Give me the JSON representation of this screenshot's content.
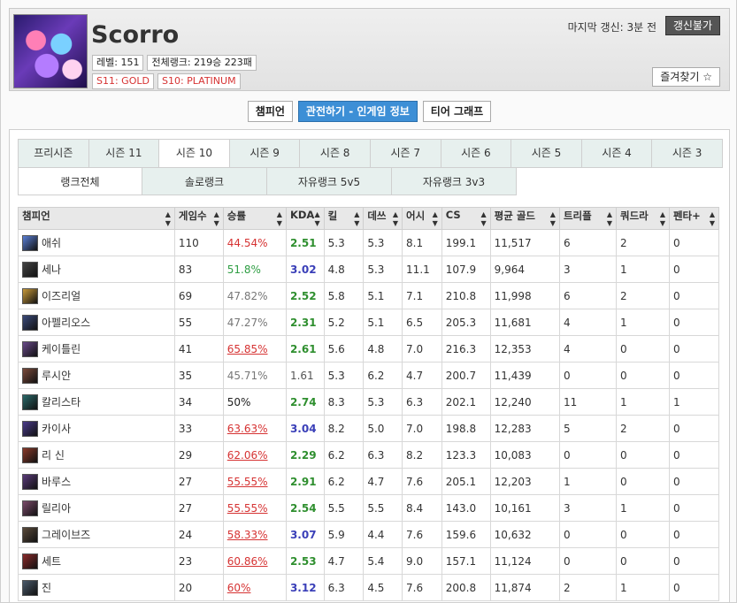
{
  "summoner": {
    "name": "Scorro",
    "level": "레벨: 151",
    "overall_rank": "전체랭크: 219승 223패",
    "ranks": [
      "S11: GOLD",
      "S10: PLATINUM"
    ]
  },
  "header": {
    "last_update": "마지막 갱신: 3분 전",
    "refresh_button": "갱신불가",
    "favorite_button": "즐겨찾기 ☆"
  },
  "view_tabs": [
    "챔피언",
    "관전하기 - 인게임 정보",
    "티어 그래프"
  ],
  "season_tabs": [
    "프리시즌",
    "시즌 11",
    "시즌 10",
    "시즌 9",
    "시즌 8",
    "시즌 7",
    "시즌 6",
    "시즌 5",
    "시즌 4",
    "시즌 3"
  ],
  "queue_tabs": [
    "랭크전체",
    "솔로랭크",
    "자유랭크 5v5",
    "자유랭크 3v3"
  ],
  "table": {
    "headers": [
      "챔피언",
      "게임수",
      "승률",
      "KDA",
      "킬",
      "데쓰",
      "어시",
      "CS",
      "평균 골드",
      "트리플",
      "쿼드라",
      "펜타+"
    ],
    "sort_icon": "▲▼",
    "rows": [
      {
        "champ": "애쉬",
        "games": "110",
        "wr": "44.54%",
        "wr_style": "wr-low-red",
        "kda": "2.51",
        "kda_style": "green",
        "k": "5.3",
        "d": "5.3",
        "a": "8.1",
        "cs": "199.1",
        "gold": "11,517",
        "triple": "6",
        "quadra": "2",
        "penta": "0",
        "color": "#5a7fd6"
      },
      {
        "champ": "세나",
        "games": "83",
        "wr": "51.8%",
        "wr_style": "mid",
        "kda": "3.02",
        "kda_style": "blue",
        "k": "4.8",
        "d": "5.3",
        "a": "11.1",
        "cs": "107.9",
        "gold": "9,964",
        "triple": "3",
        "quadra": "1",
        "penta": "0",
        "color": "#444"
      },
      {
        "champ": "이즈리얼",
        "games": "69",
        "wr": "47.82%",
        "wr_style": "low",
        "kda": "2.52",
        "kda_style": "green",
        "k": "5.8",
        "d": "5.1",
        "a": "7.1",
        "cs": "210.8",
        "gold": "11,998",
        "triple": "6",
        "quadra": "2",
        "penta": "0",
        "color": "#c89a3a"
      },
      {
        "champ": "아펠리오스",
        "games": "55",
        "wr": "47.27%",
        "wr_style": "low",
        "kda": "2.31",
        "kda_style": "green",
        "k": "5.2",
        "d": "5.1",
        "a": "6.5",
        "cs": "205.3",
        "gold": "11,681",
        "triple": "4",
        "quadra": "1",
        "penta": "0",
        "color": "#3a4a7a"
      },
      {
        "champ": "케이틀린",
        "games": "41",
        "wr": "65.85%",
        "wr_style": "good",
        "kda": "2.61",
        "kda_style": "green",
        "k": "5.6",
        "d": "4.8",
        "a": "7.0",
        "cs": "216.3",
        "gold": "12,353",
        "triple": "4",
        "quadra": "0",
        "penta": "0",
        "color": "#6a4a8a"
      },
      {
        "champ": "루시안",
        "games": "35",
        "wr": "45.71%",
        "wr_style": "low",
        "kda": "1.61",
        "kda_style": "gray",
        "k": "5.3",
        "d": "6.2",
        "a": "4.7",
        "cs": "200.7",
        "gold": "11,439",
        "triple": "0",
        "quadra": "0",
        "penta": "0",
        "color": "#7a4a3a"
      },
      {
        "champ": "칼리스타",
        "games": "34",
        "wr": "50%",
        "wr_style": "even",
        "kda": "2.74",
        "kda_style": "green",
        "k": "8.3",
        "d": "5.3",
        "a": "6.3",
        "cs": "202.1",
        "gold": "12,240",
        "triple": "11",
        "quadra": "1",
        "penta": "1",
        "color": "#2a6a6a"
      },
      {
        "champ": "카이사",
        "games": "33",
        "wr": "63.63%",
        "wr_style": "good",
        "kda": "3.04",
        "kda_style": "blue",
        "k": "8.2",
        "d": "5.0",
        "a": "7.0",
        "cs": "198.8",
        "gold": "12,283",
        "triple": "5",
        "quadra": "2",
        "penta": "0",
        "color": "#4a3a8a"
      },
      {
        "champ": "리 신",
        "games": "29",
        "wr": "62.06%",
        "wr_style": "good",
        "kda": "2.29",
        "kda_style": "green",
        "k": "6.2",
        "d": "6.3",
        "a": "8.2",
        "cs": "123.3",
        "gold": "10,083",
        "triple": "0",
        "quadra": "0",
        "penta": "0",
        "color": "#8a3a2a"
      },
      {
        "champ": "바루스",
        "games": "27",
        "wr": "55.55%",
        "wr_style": "good",
        "kda": "2.91",
        "kda_style": "green",
        "k": "6.2",
        "d": "4.7",
        "a": "7.6",
        "cs": "205.1",
        "gold": "12,203",
        "triple": "1",
        "quadra": "0",
        "penta": "0",
        "color": "#5a3a7a"
      },
      {
        "champ": "릴리아",
        "games": "27",
        "wr": "55.55%",
        "wr_style": "good",
        "kda": "2.54",
        "kda_style": "green",
        "k": "5.5",
        "d": "5.5",
        "a": "8.4",
        "cs": "143.0",
        "gold": "10,161",
        "triple": "3",
        "quadra": "1",
        "penta": "0",
        "color": "#7a4a6a"
      },
      {
        "champ": "그레이브즈",
        "games": "24",
        "wr": "58.33%",
        "wr_style": "good",
        "kda": "3.07",
        "kda_style": "blue",
        "k": "5.9",
        "d": "4.4",
        "a": "7.6",
        "cs": "159.6",
        "gold": "10,632",
        "triple": "0",
        "quadra": "0",
        "penta": "0",
        "color": "#5a4a3a"
      },
      {
        "champ": "세트",
        "games": "23",
        "wr": "60.86%",
        "wr_style": "good",
        "kda": "2.53",
        "kda_style": "green",
        "k": "4.7",
        "d": "5.4",
        "a": "9.0",
        "cs": "157.1",
        "gold": "11,124",
        "triple": "0",
        "quadra": "0",
        "penta": "0",
        "color": "#8a2a2a"
      },
      {
        "champ": "진",
        "games": "20",
        "wr": "60%",
        "wr_style": "good",
        "kda": "3.12",
        "kda_style": "blue",
        "k": "6.3",
        "d": "4.5",
        "a": "7.6",
        "cs": "200.8",
        "gold": "11,874",
        "triple": "2",
        "quadra": "1",
        "penta": "0",
        "color": "#4a5a6a"
      }
    ]
  }
}
